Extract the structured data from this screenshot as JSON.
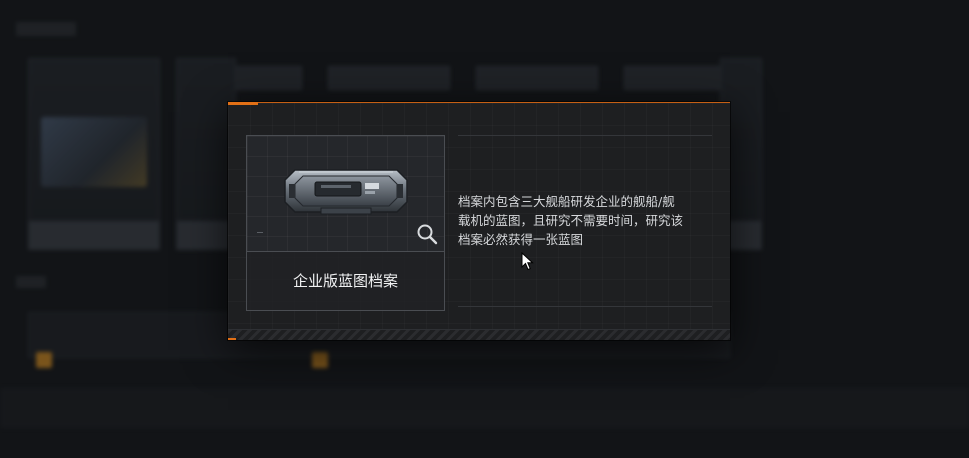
{
  "modal": {
    "item_name": "企业版蓝图档案",
    "description": "档案内包含三大舰船研发企业的舰船/舰\n载机的蓝图，且研究不需要时间，研究该\n档案必然获得一张蓝图",
    "icons": {
      "item": "ship-blueprint-archive-icon",
      "inspect": "magnifier-icon"
    }
  },
  "colors": {
    "accent": "#e27016",
    "panel": "#1e1f21",
    "text": "#d6d8db"
  }
}
